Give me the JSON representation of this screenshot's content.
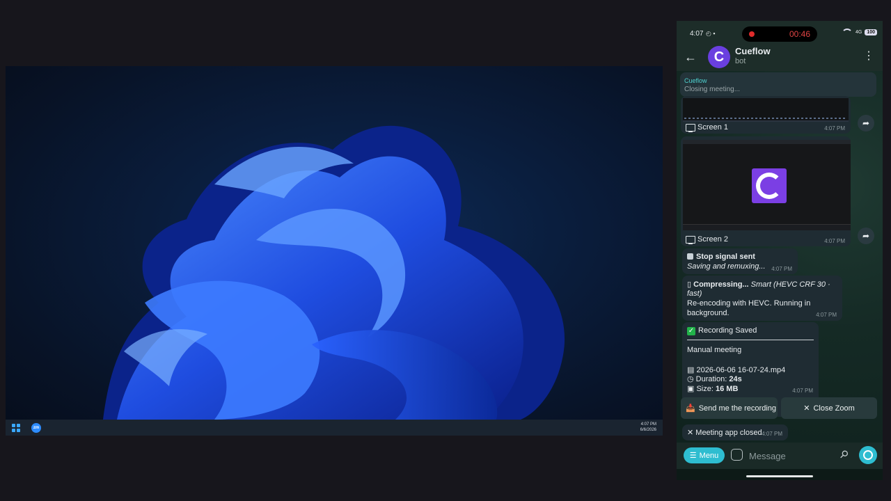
{
  "desktop": {
    "tray_time": "4:07 PM",
    "tray_date": "6/6/2026",
    "icons": [
      "windows-start-icon",
      "zoom-app-icon"
    ]
  },
  "phone": {
    "status_bar": {
      "time": "4:07",
      "recording_timer": "00:46",
      "network": "4G",
      "battery": "100"
    },
    "app_bar": {
      "avatar_letter": "C",
      "title": "Cueflow",
      "subtitle": "bot"
    },
    "reply_preview": {
      "name": "Cueflow",
      "text": "Closing meeting..."
    },
    "messages": {
      "screen1": {
        "caption": "Screen 1",
        "time": "4:07 PM"
      },
      "screen2": {
        "caption": "Screen 2",
        "time": "4:07 PM"
      },
      "stop": {
        "title": "Stop signal sent",
        "subtitle": "Saving and remuxing...",
        "time": "4:07 PM"
      },
      "compress": {
        "title": "Compressing...",
        "mode_a": "Smart (HEVC CRF 30 ·",
        "mode_b": "fast)",
        "line1": "Re-encoding with HEVC. Running in",
        "line2": "background.",
        "time": "4:07 PM"
      },
      "saved": {
        "title": "Recording Saved",
        "meeting": "Manual meeting",
        "file": "2026-06-06 16-07-24.mp4",
        "duration_label": "Duration:",
        "duration": "24s",
        "size_label": "Size:",
        "size": "16 MB",
        "time": "4:07 PM"
      },
      "closed": {
        "text": "Meeting app closed",
        "time": "4:07 PM"
      }
    },
    "keyboard_buttons": {
      "send": "Send me the recording",
      "close": "Close Zoom"
    },
    "input": {
      "menu_label": "Menu",
      "placeholder": "Message"
    },
    "colors": {
      "accent": "#2ebdd0",
      "avatar": "#6a3fe0",
      "recording": "#e02b2b"
    }
  }
}
